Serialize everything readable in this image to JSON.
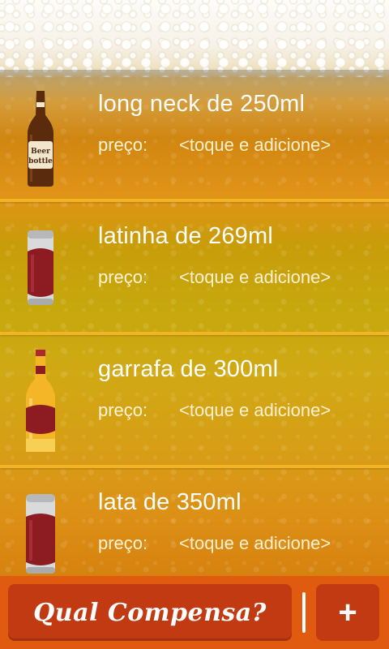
{
  "items": [
    {
      "title": "long neck de 250ml",
      "price_label": "preço:",
      "price_hint": "<toque e adicione>",
      "icon": "long-neck-bottle-icon"
    },
    {
      "title": "latinha de 269ml",
      "price_label": "preço:",
      "price_hint": "<toque e adicione>",
      "icon": "small-can-icon"
    },
    {
      "title": "garrafa de 300ml",
      "price_label": "preço:",
      "price_hint": "<toque e adicione>",
      "icon": "bottle-icon"
    },
    {
      "title": "lata de 350ml",
      "price_label": "preço:",
      "price_hint": "<toque e adicione>",
      "icon": "can-icon"
    }
  ],
  "bottle_label_text": {
    "line1": "Beer",
    "line2": "bottle"
  },
  "bottom_bar": {
    "main_button_label": "Qual Compensa?",
    "add_button_label": "+"
  },
  "colors": {
    "accent": "#e05a10",
    "button": "#c23a12",
    "divider": "#f0b425"
  }
}
